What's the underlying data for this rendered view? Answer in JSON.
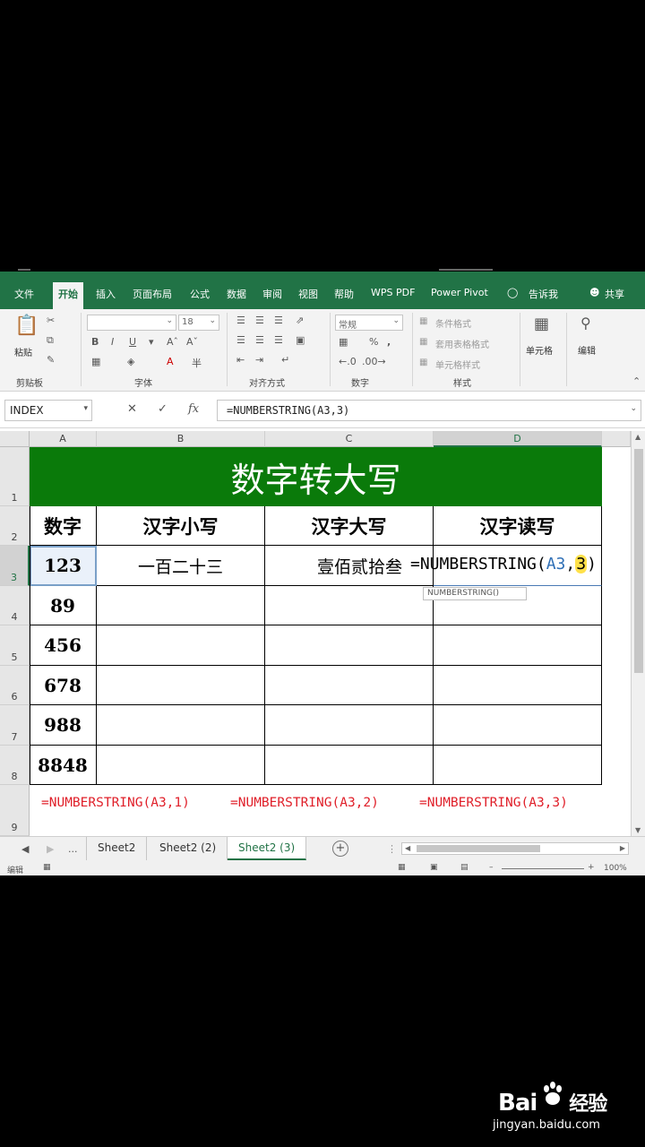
{
  "ribbon": {
    "tabs": [
      "文件",
      "开始",
      "插入",
      "页面布局",
      "公式",
      "数据",
      "审阅",
      "视图",
      "帮助",
      "WPS PDF",
      "Power Pivot"
    ],
    "tell_me": "告诉我",
    "share": "共享",
    "clipboard": {
      "paste": "粘贴",
      "label": "剪贴板"
    },
    "font": {
      "font_size": "18",
      "label": "字体",
      "bold": "B",
      "italic": "I",
      "underline": "U"
    },
    "alignment": {
      "label": "对齐方式"
    },
    "number": {
      "format": "常规",
      "label": "数字"
    },
    "styles": {
      "conditional": "条件格式",
      "table": "套用表格格式",
      "cell_styles": "单元格样式",
      "label": "样式"
    },
    "cells": {
      "label": "单元格"
    },
    "editing": {
      "label": "编辑"
    }
  },
  "formula_bar": {
    "name_box": "INDEX",
    "formula": "=NUMBERSTRING(A3,3)"
  },
  "sheet": {
    "columns": [
      "A",
      "B",
      "C",
      "D"
    ],
    "rows": [
      "1",
      "2",
      "3",
      "4",
      "5",
      "6",
      "7",
      "8",
      "9"
    ],
    "title": "数字转大写",
    "headers": [
      "数字",
      "汉字小写",
      "汉字大写",
      "汉字读写"
    ],
    "numbers": [
      "123",
      "89",
      "456",
      "678",
      "988",
      "8848"
    ],
    "b3": "一百二十三",
    "c3": "壹佰贰拾叁",
    "d3_edit": {
      "prefix": "=NUMBERSTRING(",
      "ref": "A3",
      "comma": ",",
      "arg": "3",
      "close": ")"
    },
    "tooltip": "NUMBERSTRING()",
    "row9": [
      "=NUMBERSTRING(A3,1)",
      "=NUMBERSTRING(A3,2)",
      "=NUMBERSTRING(A3,3)"
    ]
  },
  "sheet_tabs": {
    "ellipsis": "...",
    "tabs": [
      "Sheet2",
      "Sheet2 (2)",
      "Sheet2 (3)"
    ]
  },
  "status": {
    "mode": "编辑",
    "zoom": "100%"
  },
  "watermark": {
    "brand": "Bai",
    "brand2": "经验",
    "url": "jingyan.baidu.com"
  }
}
